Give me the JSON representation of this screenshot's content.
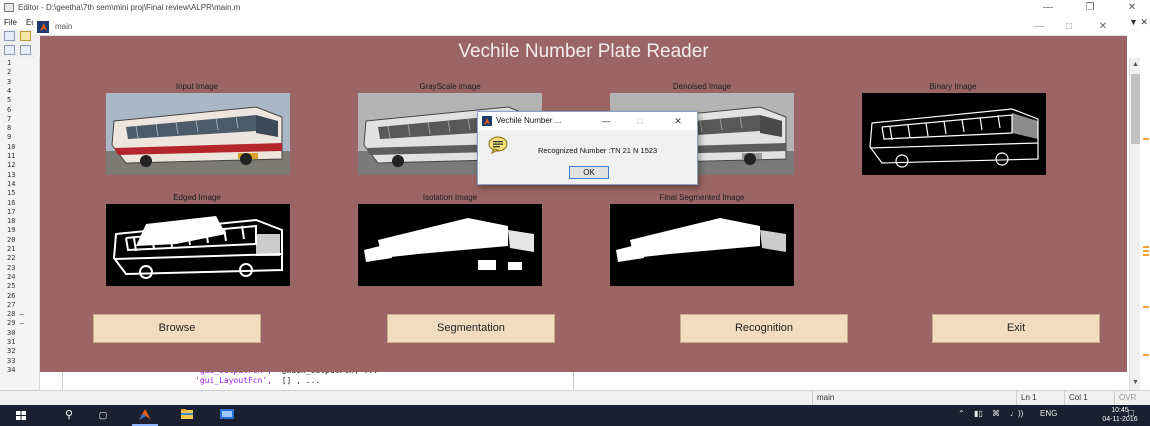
{
  "editor": {
    "title": "Editor - D:\\geetha\\7th sem\\mini proj\\Final review\\ALPR\\main.m",
    "menu": [
      "File",
      "Ed"
    ],
    "line_numbers": [
      "1",
      "2",
      "3",
      "4",
      "5",
      "6",
      "7",
      "8",
      "9",
      "10",
      "11",
      "12",
      "13",
      "14",
      "15",
      "16",
      "17",
      "18",
      "19",
      "20",
      "21",
      "22",
      "23",
      "24",
      "25",
      "26",
      "27",
      "28 —",
      "29 —",
      "30",
      "31",
      "32",
      "33",
      "34"
    ],
    "code": [
      {
        "str": "'gui_OutputFcn',",
        "rest": "  @main_OutputFcn, ..."
      },
      {
        "str": "'gui_LayoutFcn',",
        "rest": "  [] , ..."
      }
    ],
    "status": {
      "file": "main",
      "ln": "Ln  1",
      "col": "Col  1",
      "mode": "OVR"
    }
  },
  "figure": {
    "window_title": "main",
    "heading": "Vechile Number Plate Reader",
    "panels": [
      {
        "label": "Input Image",
        "kind": "color"
      },
      {
        "label": "GrayScale image",
        "kind": "gray"
      },
      {
        "label": "Denoised Image",
        "kind": "gray"
      },
      {
        "label": "Binary Image",
        "kind": "binary"
      },
      {
        "label": "Edged Image",
        "kind": "edged"
      },
      {
        "label": "Isolation Image",
        "kind": "isolation"
      },
      {
        "label": "Final Segmented Image",
        "kind": "segmented"
      }
    ],
    "buttons": {
      "browse": "Browse",
      "segmentation": "Segmentation",
      "recognition": "Recognition",
      "exit": "Exit"
    },
    "background_color": "#9b6565",
    "button_color": "#f2dcc0"
  },
  "dialog": {
    "title": "Vechile Number ...",
    "message": "Recognized Number :TN 21 N 1523",
    "ok": "OK",
    "icon": "speech-bubble-info-icon"
  },
  "taskbar": {
    "tray": "ENG",
    "time": "10:45",
    "date": "04-11-2016"
  }
}
